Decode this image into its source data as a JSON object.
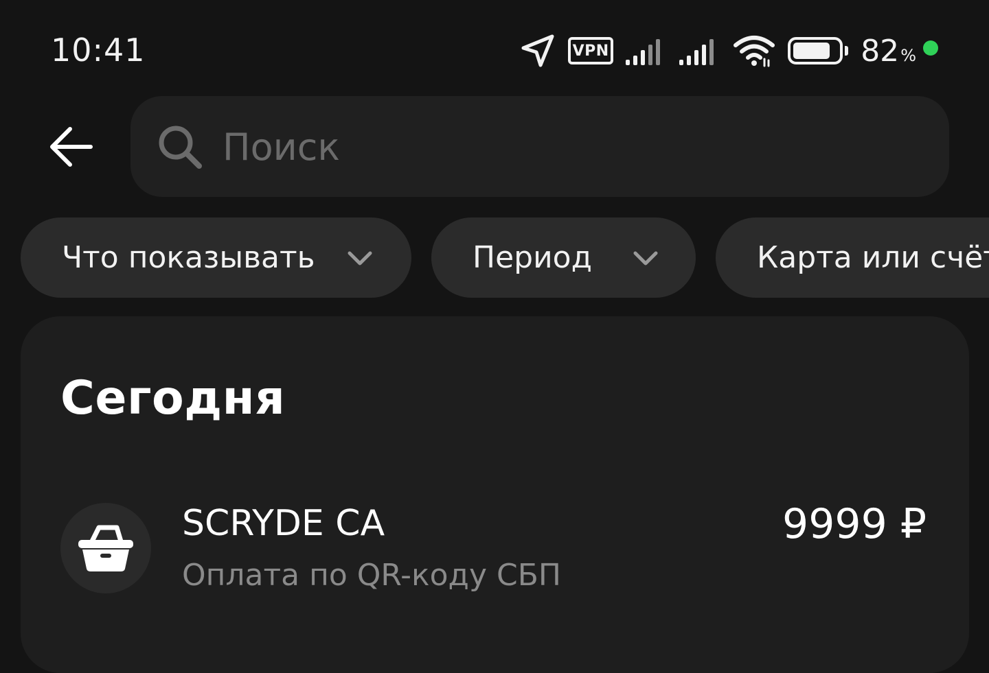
{
  "status_bar": {
    "time": "10:41",
    "vpn_label": "VPN",
    "battery_percent": "82",
    "battery_unit": "%",
    "battery_level": 0.82,
    "indicator_color": "#2fd158",
    "icons": [
      "location-arrow-icon",
      "vpn-icon",
      "signal-icon",
      "signal-icon",
      "wifi-icon",
      "battery-icon"
    ]
  },
  "header": {
    "back_icon": "arrow-left-icon",
    "search": {
      "icon": "search-icon",
      "value": "",
      "placeholder": "Поиск"
    }
  },
  "filters": [
    {
      "label": "Что показывать",
      "icon": "chevron-down-icon"
    },
    {
      "label": "Период",
      "icon": "chevron-down-icon"
    },
    {
      "label": "Карта или счёт"
    }
  ],
  "sections": [
    {
      "title": "Сегодня",
      "transactions": [
        {
          "icon": "shopping-basket-icon",
          "title": "SCRYDE CA",
          "subtitle": "Оплата по QR-коду СБП",
          "amount": "9999 ₽"
        }
      ]
    }
  ],
  "colors": {
    "background": "#141414",
    "search_bg": "#202020",
    "chip_bg": "#2b2b2b",
    "card_bg": "#1e1e1e",
    "secondary_text": "#8a8a8a",
    "placeholder_text": "#6b6b6b"
  }
}
